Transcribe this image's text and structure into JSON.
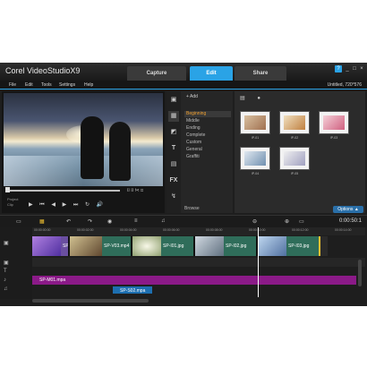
{
  "app": {
    "logo": "Corel VideoStudioX9",
    "tabs": [
      "Capture",
      "Edit",
      "Share"
    ],
    "active_tab": "Edit",
    "window_buttons": [
      "?",
      "_",
      "□",
      "×"
    ]
  },
  "menubar": {
    "items": [
      "File",
      "Edit",
      "Tools",
      "Settings",
      "Help"
    ],
    "project_info": "Untitled, 720*576"
  },
  "player": {
    "mode_labels": [
      "Project",
      "Clip"
    ],
    "transport": "▶ ⏮ ◀ ▶ ⏭ ↻ 🔊"
  },
  "library": {
    "add_label": "Add",
    "categories": [
      "Beginning",
      "Middle",
      "Ending",
      "Complete",
      "Custom",
      "General",
      "Graffiti"
    ],
    "selected_category": "Beginning",
    "browse_label": "Browse",
    "thumbs": [
      "IP-01",
      "IP-02",
      "IP-03",
      "IP-04",
      "IP-05"
    ],
    "options_label": "Options ▲",
    "side_icons": [
      "media-icon",
      "instant-project-icon",
      "transition-icon",
      "title-icon",
      "graphic-icon",
      "fx-icon",
      "path-icon"
    ]
  },
  "timeline": {
    "timecode": "0:00:50:1",
    "ruler_ticks": [
      "00:00:00:00",
      "00:00:02:00",
      "00:00:04:00",
      "00:00:06:00",
      "00:00:08:00",
      "00:00:10:00",
      "00:00:12:00",
      "00:00:14:00"
    ],
    "video_clips": [
      {
        "label": "SP",
        "color": "#6a4fa0"
      },
      {
        "label": "SP-V03.mp4",
        "color": "#2f6d5a"
      },
      {
        "label": "SP-I01.jpg",
        "color": "#2f6d5a"
      },
      {
        "label": "SP-I02.jpg",
        "color": "#2f6d5a"
      },
      {
        "label": "SP-I03.jpg",
        "color": "#2f6d5a"
      }
    ],
    "audio_clips": [
      "SP-M01.mpa",
      "SP-S02.mpa"
    ]
  },
  "colors": {
    "accent": "#2aa3e6",
    "music_track": "#8b1a88",
    "sound_track": "#1d6fb0"
  }
}
